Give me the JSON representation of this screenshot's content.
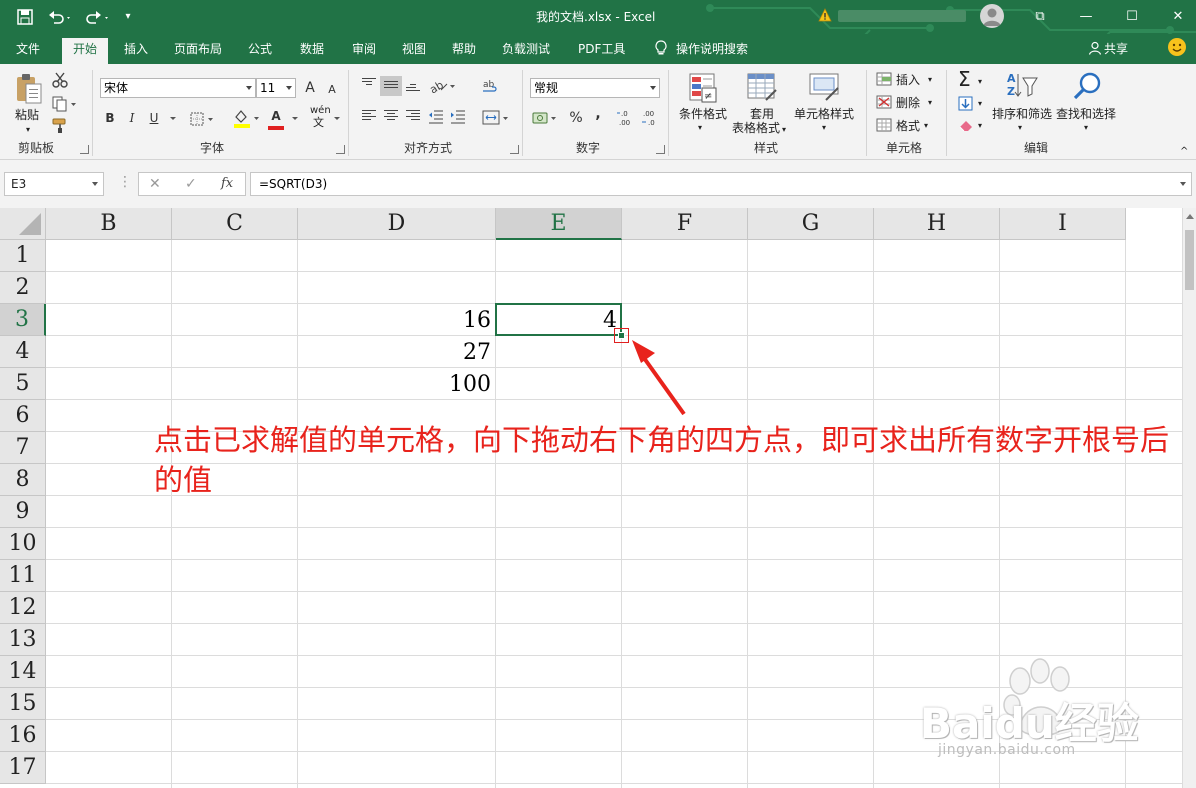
{
  "window": {
    "title": "我的文档.xlsx  -  Excel",
    "win_controls": [
      "⧉",
      "—",
      "☐",
      "✕"
    ]
  },
  "quick_access": {
    "customize": "▾"
  },
  "tabs": [
    "文件",
    "开始",
    "插入",
    "页面布局",
    "公式",
    "数据",
    "审阅",
    "视图",
    "帮助",
    "负载测试",
    "PDF工具"
  ],
  "active_tab": "开始",
  "tell_me": "操作说明搜索",
  "share": "共享",
  "ribbon": {
    "clipboard": {
      "label": "剪贴板",
      "paste": "粘贴"
    },
    "font": {
      "label": "字体",
      "font_name": "宋体",
      "font_size": "11",
      "grow": "A",
      "shrink": "A",
      "bold": "B",
      "italic": "I",
      "underline": "U",
      "font_color": "A",
      "wen": "wén",
      "wen_char": "文"
    },
    "alignment": {
      "label": "对齐方式"
    },
    "number": {
      "label": "数字",
      "format": "常规",
      "percent": "%",
      "comma": ",",
      "inc_decimal": "←.0\n.00",
      "dec_decimal": ".00\n→.0"
    },
    "styles": {
      "label": "样式",
      "conditional": "条件格式",
      "table_line1": "套用",
      "table_line2": "表格格式",
      "cell_styles": "单元格样式"
    },
    "cells": {
      "label": "单元格",
      "insert": "插入",
      "delete": "删除",
      "format": "格式"
    },
    "editing": {
      "label": "编辑",
      "sort_filter": "排序和筛选",
      "find_select": "查找和选择",
      "sigma": "Σ"
    }
  },
  "formula_bar": {
    "name_box": "E3",
    "cancel": "✕",
    "enter": "✓",
    "fx": "fx",
    "formula": "=SQRT(D3)"
  },
  "sheet": {
    "columns": [
      "B",
      "C",
      "D",
      "E",
      "F",
      "G",
      "H",
      "I"
    ],
    "rows": [
      "1",
      "2",
      "3",
      "4",
      "5",
      "6",
      "7",
      "8",
      "9",
      "10",
      "11",
      "12",
      "13",
      "14",
      "15",
      "16",
      "17"
    ],
    "selected_cell": "E3",
    "cells": {
      "D3": "16",
      "E3": "4",
      "D4": "27",
      "D5": "100"
    }
  },
  "annotation": "点击已求解值的单元格，向下拖动右下角的四方点，即可求出所有数字开根号后的值",
  "watermark": {
    "brand": "Baidu经验",
    "url": "jingyan.baidu.com"
  },
  "colors": {
    "excel_green": "#217346",
    "annotation_red": "#e8231c"
  }
}
